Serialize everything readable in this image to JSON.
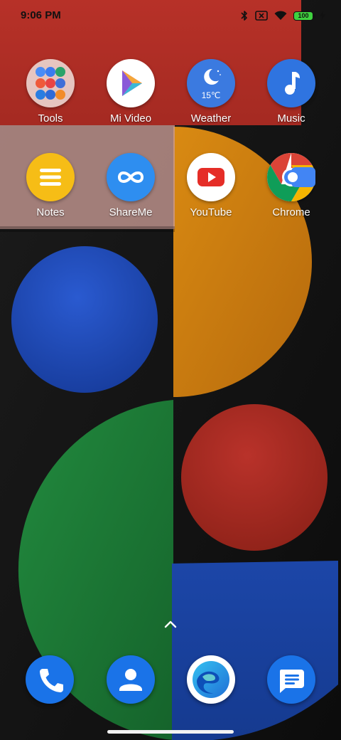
{
  "status_bar": {
    "time": "9:06 PM",
    "battery": "100",
    "icons": [
      "bluetooth-icon",
      "no-sim-icon",
      "wifi-icon",
      "battery-icon",
      "charging-icon"
    ]
  },
  "home": {
    "row1": [
      {
        "label": "Tools",
        "icon": "tools-folder-icon"
      },
      {
        "label": "Mi Video",
        "icon": "mi-video-icon"
      },
      {
        "label": "Weather",
        "icon": "weather-icon",
        "temp": "15℃"
      },
      {
        "label": "Music",
        "icon": "music-icon"
      }
    ],
    "row2": [
      {
        "label": "Notes",
        "icon": "notes-icon"
      },
      {
        "label": "ShareMe",
        "icon": "shareme-icon"
      },
      {
        "label": "YouTube",
        "icon": "youtube-icon"
      },
      {
        "label": "Chrome",
        "icon": "chrome-icon"
      }
    ]
  },
  "dock": [
    {
      "name": "phone",
      "icon": "phone-icon",
      "color": "#1a73e8"
    },
    {
      "name": "contacts",
      "icon": "contacts-icon",
      "color": "#1a73e8"
    },
    {
      "name": "browser",
      "icon": "browser-icon",
      "color": "#ffffff"
    },
    {
      "name": "messages",
      "icon": "messages-icon",
      "color": "#1a73e8"
    }
  ],
  "colors": {
    "red": "#b0322b",
    "orange": "#d07a10",
    "blue": "#1f4fbf",
    "green": "#1d7a37",
    "accent_blue": "#1a73e8",
    "notes_yellow": "#f6bd16"
  }
}
